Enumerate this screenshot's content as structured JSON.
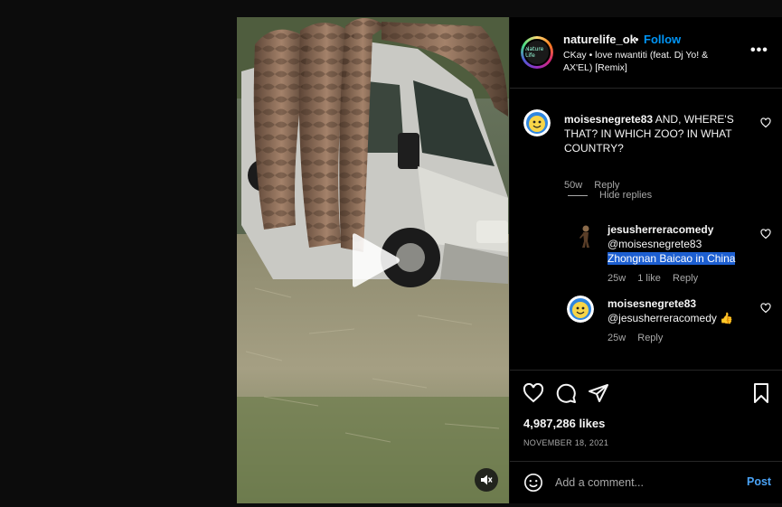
{
  "post": {
    "username": "naturelife_ok",
    "dot": "•",
    "follow": "Follow",
    "audio": "CKay • love nwantiti (feat. Dj Yo! & AX'EL) [Remix]",
    "avatar_text": "Nature Life"
  },
  "comments": [
    {
      "username": "moisesnegrete83",
      "text": "AND, WHERE'S THAT? IN WHICH ZOO? IN WHAT COUNTRY?",
      "age": "50w",
      "reply": "Reply",
      "avatar_icon": "smiley-face-icon"
    }
  ],
  "hide_replies": "Hide replies",
  "replies": [
    {
      "username": "jesusherreracomedy",
      "mention": "@moisesnegrete83",
      "text": "Zhongnan Baicao in China",
      "age": "25w",
      "likes": "1 like",
      "reply": "Reply",
      "avatar_icon": "person-silhouette-icon"
    },
    {
      "username": "moisesnegrete83",
      "mention": "@jesusherreracomedy",
      "emoji": "👍",
      "age": "25w",
      "reply": "Reply",
      "avatar_icon": "smiley-face-icon"
    }
  ],
  "stats": {
    "likes": "4,987,286 likes",
    "date": "NOVEMBER 18, 2021"
  },
  "composer": {
    "placeholder": "Add a comment...",
    "post": "Post"
  },
  "colors": {
    "follow_blue": "#0095f6",
    "post_blue": "#4aa3f6",
    "selection": "#1d5fd1",
    "background": "#000000"
  }
}
